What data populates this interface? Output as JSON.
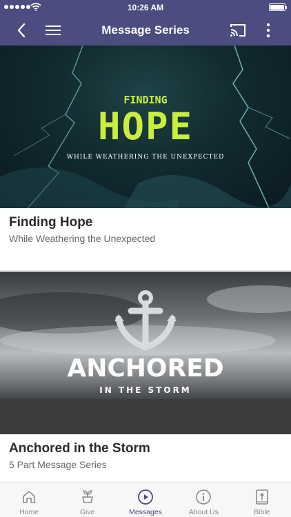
{
  "status_bar": {
    "time": "10:26 AM"
  },
  "nav": {
    "title": "Message Series"
  },
  "series": [
    {
      "title": "Finding Hope",
      "subtitle": "While Weathering the Unexpected",
      "art": {
        "small_text": "FINDING",
        "big_text": "HOPE",
        "tagline": "WHILE WEATHERING THE UNEXPECTED"
      }
    },
    {
      "title": "Anchored in the Storm",
      "subtitle": "5 Part Message Series",
      "art": {
        "big_text": "ANCHORED",
        "tagline": "IN THE STORM"
      }
    }
  ],
  "tabs": [
    {
      "label": "Home",
      "icon": "home-icon",
      "active": false
    },
    {
      "label": "Give",
      "icon": "give-icon",
      "active": false
    },
    {
      "label": "Messages",
      "icon": "messages-play-icon",
      "active": true
    },
    {
      "label": "About Us",
      "icon": "info-icon",
      "active": false
    },
    {
      "label": "Bible",
      "icon": "bible-icon",
      "active": false
    }
  ],
  "colors": {
    "header_bg": "#4b4c7f",
    "accent": "#4b4c7f",
    "hope_green": "#c9ef3c",
    "tab_inactive": "#8a8a8a"
  }
}
